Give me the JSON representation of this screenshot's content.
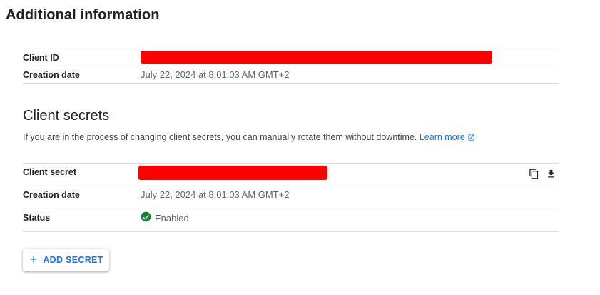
{
  "section_title": "Additional information",
  "client_info": {
    "client_id_label": "Client ID",
    "creation_date_label": "Creation date",
    "creation_date_value": "July 22, 2024 at 8:01:03 AM GMT+2"
  },
  "client_secrets": {
    "title": "Client secrets",
    "description": "If you are in the process of changing client secrets, you can manually rotate them without downtime.",
    "learn_more": "Learn more",
    "secret_label": "Client secret",
    "creation_date_label": "Creation date",
    "creation_date_value": "July 22, 2024 at 8:01:03 AM GMT+2",
    "status_label": "Status",
    "status_value": "Enabled",
    "add_secret_label": "ADD SECRET"
  },
  "colors": {
    "accent": "#1a73e8",
    "redaction": "#ff0000",
    "status_ok": "#188038",
    "divider": "#dadce0"
  },
  "icons": [
    "external-link-icon",
    "copy-icon",
    "download-icon",
    "check-circle-icon",
    "plus-icon"
  ]
}
